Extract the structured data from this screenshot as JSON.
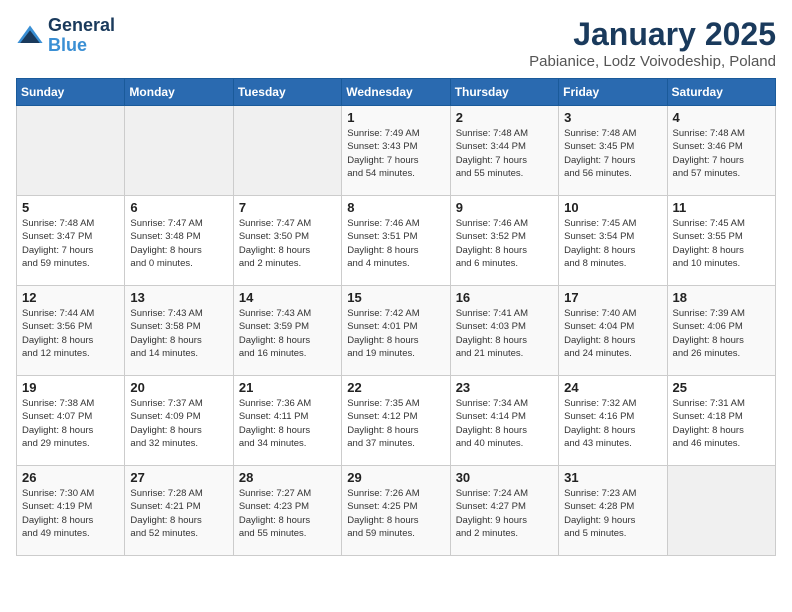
{
  "logo": {
    "line1": "General",
    "line2": "Blue"
  },
  "title": "January 2025",
  "subtitle": "Pabianice, Lodz Voivodeship, Poland",
  "weekdays": [
    "Sunday",
    "Monday",
    "Tuesday",
    "Wednesday",
    "Thursday",
    "Friday",
    "Saturday"
  ],
  "weeks": [
    [
      {
        "day": "",
        "info": ""
      },
      {
        "day": "",
        "info": ""
      },
      {
        "day": "",
        "info": ""
      },
      {
        "day": "1",
        "info": "Sunrise: 7:49 AM\nSunset: 3:43 PM\nDaylight: 7 hours\nand 54 minutes."
      },
      {
        "day": "2",
        "info": "Sunrise: 7:48 AM\nSunset: 3:44 PM\nDaylight: 7 hours\nand 55 minutes."
      },
      {
        "day": "3",
        "info": "Sunrise: 7:48 AM\nSunset: 3:45 PM\nDaylight: 7 hours\nand 56 minutes."
      },
      {
        "day": "4",
        "info": "Sunrise: 7:48 AM\nSunset: 3:46 PM\nDaylight: 7 hours\nand 57 minutes."
      }
    ],
    [
      {
        "day": "5",
        "info": "Sunrise: 7:48 AM\nSunset: 3:47 PM\nDaylight: 7 hours\nand 59 minutes."
      },
      {
        "day": "6",
        "info": "Sunrise: 7:47 AM\nSunset: 3:48 PM\nDaylight: 8 hours\nand 0 minutes."
      },
      {
        "day": "7",
        "info": "Sunrise: 7:47 AM\nSunset: 3:50 PM\nDaylight: 8 hours\nand 2 minutes."
      },
      {
        "day": "8",
        "info": "Sunrise: 7:46 AM\nSunset: 3:51 PM\nDaylight: 8 hours\nand 4 minutes."
      },
      {
        "day": "9",
        "info": "Sunrise: 7:46 AM\nSunset: 3:52 PM\nDaylight: 8 hours\nand 6 minutes."
      },
      {
        "day": "10",
        "info": "Sunrise: 7:45 AM\nSunset: 3:54 PM\nDaylight: 8 hours\nand 8 minutes."
      },
      {
        "day": "11",
        "info": "Sunrise: 7:45 AM\nSunset: 3:55 PM\nDaylight: 8 hours\nand 10 minutes."
      }
    ],
    [
      {
        "day": "12",
        "info": "Sunrise: 7:44 AM\nSunset: 3:56 PM\nDaylight: 8 hours\nand 12 minutes."
      },
      {
        "day": "13",
        "info": "Sunrise: 7:43 AM\nSunset: 3:58 PM\nDaylight: 8 hours\nand 14 minutes."
      },
      {
        "day": "14",
        "info": "Sunrise: 7:43 AM\nSunset: 3:59 PM\nDaylight: 8 hours\nand 16 minutes."
      },
      {
        "day": "15",
        "info": "Sunrise: 7:42 AM\nSunset: 4:01 PM\nDaylight: 8 hours\nand 19 minutes."
      },
      {
        "day": "16",
        "info": "Sunrise: 7:41 AM\nSunset: 4:03 PM\nDaylight: 8 hours\nand 21 minutes."
      },
      {
        "day": "17",
        "info": "Sunrise: 7:40 AM\nSunset: 4:04 PM\nDaylight: 8 hours\nand 24 minutes."
      },
      {
        "day": "18",
        "info": "Sunrise: 7:39 AM\nSunset: 4:06 PM\nDaylight: 8 hours\nand 26 minutes."
      }
    ],
    [
      {
        "day": "19",
        "info": "Sunrise: 7:38 AM\nSunset: 4:07 PM\nDaylight: 8 hours\nand 29 minutes."
      },
      {
        "day": "20",
        "info": "Sunrise: 7:37 AM\nSunset: 4:09 PM\nDaylight: 8 hours\nand 32 minutes."
      },
      {
        "day": "21",
        "info": "Sunrise: 7:36 AM\nSunset: 4:11 PM\nDaylight: 8 hours\nand 34 minutes."
      },
      {
        "day": "22",
        "info": "Sunrise: 7:35 AM\nSunset: 4:12 PM\nDaylight: 8 hours\nand 37 minutes."
      },
      {
        "day": "23",
        "info": "Sunrise: 7:34 AM\nSunset: 4:14 PM\nDaylight: 8 hours\nand 40 minutes."
      },
      {
        "day": "24",
        "info": "Sunrise: 7:32 AM\nSunset: 4:16 PM\nDaylight: 8 hours\nand 43 minutes."
      },
      {
        "day": "25",
        "info": "Sunrise: 7:31 AM\nSunset: 4:18 PM\nDaylight: 8 hours\nand 46 minutes."
      }
    ],
    [
      {
        "day": "26",
        "info": "Sunrise: 7:30 AM\nSunset: 4:19 PM\nDaylight: 8 hours\nand 49 minutes."
      },
      {
        "day": "27",
        "info": "Sunrise: 7:28 AM\nSunset: 4:21 PM\nDaylight: 8 hours\nand 52 minutes."
      },
      {
        "day": "28",
        "info": "Sunrise: 7:27 AM\nSunset: 4:23 PM\nDaylight: 8 hours\nand 55 minutes."
      },
      {
        "day": "29",
        "info": "Sunrise: 7:26 AM\nSunset: 4:25 PM\nDaylight: 8 hours\nand 59 minutes."
      },
      {
        "day": "30",
        "info": "Sunrise: 7:24 AM\nSunset: 4:27 PM\nDaylight: 9 hours\nand 2 minutes."
      },
      {
        "day": "31",
        "info": "Sunrise: 7:23 AM\nSunset: 4:28 PM\nDaylight: 9 hours\nand 5 minutes."
      },
      {
        "day": "",
        "info": ""
      }
    ]
  ]
}
